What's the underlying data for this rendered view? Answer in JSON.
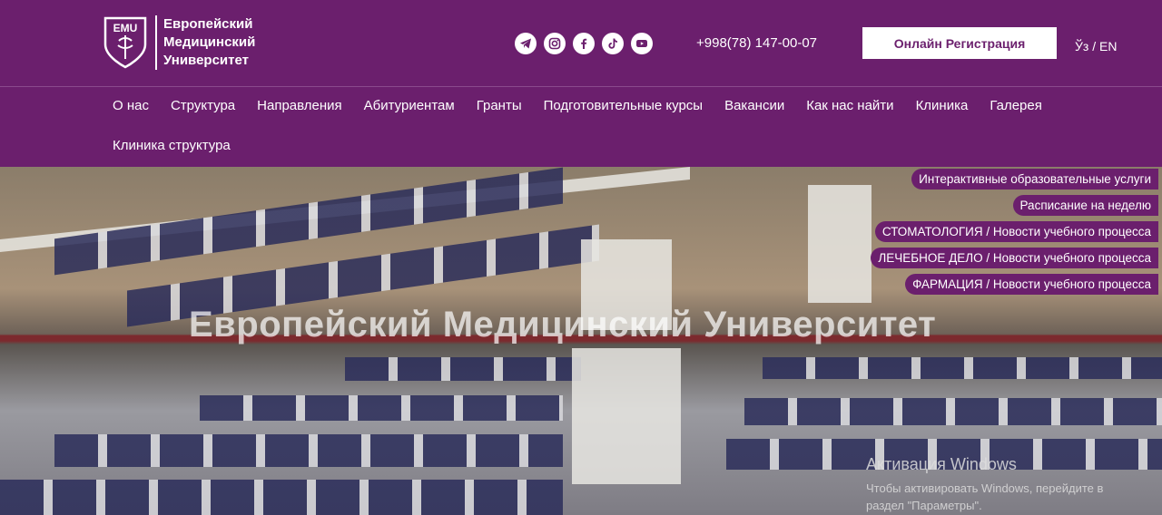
{
  "logo": {
    "badge": "EMU",
    "lines": [
      "Европейский",
      "Медицинский",
      "Университет"
    ]
  },
  "socials": [
    {
      "name": "telegram-icon",
      "glyph": "➤"
    },
    {
      "name": "instagram-icon",
      "glyph": "◎"
    },
    {
      "name": "facebook-icon",
      "glyph": "f"
    },
    {
      "name": "tiktok-icon",
      "glyph": "♪"
    },
    {
      "name": "youtube-icon",
      "glyph": "▶"
    }
  ],
  "header": {
    "phone": "+998(78) 147-00-07",
    "register_label": "Онлайн Регистрация",
    "lang": "Ўз / EN"
  },
  "nav": {
    "row1": [
      "О нас",
      "Структура",
      "Направления",
      "Абитуриентам",
      "Гранты",
      "Подготовительные курсы",
      "Вакансии",
      "Как нас найти",
      "Клиника",
      "Галерея"
    ],
    "row2": [
      "Клиника структура"
    ]
  },
  "hero": {
    "title": "Европейский Медицинский Университет"
  },
  "side_links": [
    "Интерактивные образовательные услуги",
    "Расписание на неделю",
    "СТОМАТОЛОГИЯ / Новости учебного процесса",
    "ЛЕЧЕБНОЕ ДЕЛО / Новости учебного процесса",
    "ФАРМАЦИЯ / Новости учебного процесса"
  ],
  "windows_activation": {
    "title": "Активация Windows",
    "line1": "Чтобы активировать Windows, перейдите в",
    "line2": "раздел \"Параметры\"."
  },
  "colors": {
    "brand": "#6b1f6d"
  }
}
